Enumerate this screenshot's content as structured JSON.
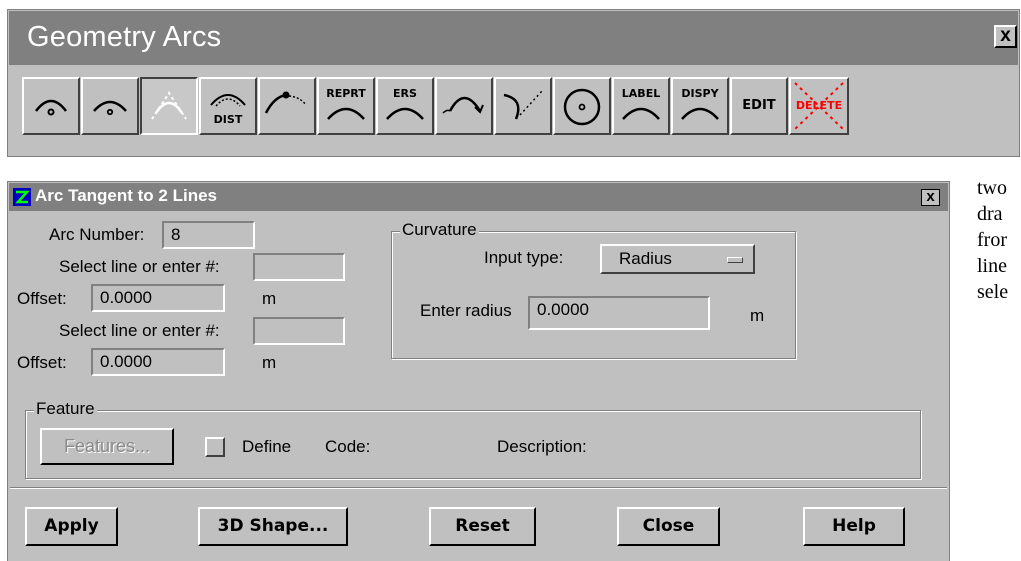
{
  "toolbar": {
    "title": "Geometry Arcs",
    "close_label": "x",
    "buttons": [
      {
        "name": "arc-center-icon",
        "text": ""
      },
      {
        "name": "arc-three-point-icon",
        "text": ""
      },
      {
        "name": "arc-tangent-icon",
        "text": "",
        "pressed": true
      },
      {
        "name": "arc-distance-icon",
        "text": "DIST"
      },
      {
        "name": "arc-from-point-icon",
        "text": ""
      },
      {
        "name": "arc-report-icon",
        "text": "REPRT"
      },
      {
        "name": "arc-erase-icon",
        "text": "ERS"
      },
      {
        "name": "arc-curve-icon",
        "text": ""
      },
      {
        "name": "arc-reverse-icon",
        "text": ""
      },
      {
        "name": "circle-icon",
        "text": ""
      },
      {
        "name": "arc-label-icon",
        "text": "LABEL"
      },
      {
        "name": "arc-display-icon",
        "text": "DISPY"
      },
      {
        "name": "edit-icon",
        "text": "EDIT"
      },
      {
        "name": "delete-icon",
        "text": "DELETE"
      }
    ]
  },
  "dialog": {
    "title": "Arc Tangent to 2 Lines",
    "close_label": "x",
    "arc_number_label": "Arc Number:",
    "arc_number_value": "8",
    "select_line_1_label": "Select line or enter #:",
    "select_line_1_value": "",
    "offset_1_label": "Offset:",
    "offset_1_value": "0.0000",
    "offset_1_unit": "m",
    "select_line_2_label": "Select line or enter #:",
    "select_line_2_value": "",
    "offset_2_label": "Offset:",
    "offset_2_value": "0.0000",
    "offset_2_unit": "m",
    "curvature": {
      "title": "Curvature",
      "input_type_label": "Input type:",
      "input_type_value": "Radius",
      "enter_radius_label": "Enter radius",
      "enter_radius_value": "0.0000",
      "radius_unit": "m"
    },
    "feature": {
      "title": "Feature",
      "features_button": "Features...",
      "define_label": "Define",
      "code_label": "Code:",
      "description_label": "Description:"
    },
    "buttons": {
      "apply": "Apply",
      "shape3d": "3D Shape...",
      "reset": "Reset",
      "close": "Close",
      "help": "Help"
    }
  },
  "side_text": [
    "two",
    "dra",
    "fror",
    "line",
    "sele"
  ],
  "colors": {
    "window_bg": "#c0c0c0",
    "title_bg": "#808080",
    "delete_accent": "#ff0000"
  }
}
